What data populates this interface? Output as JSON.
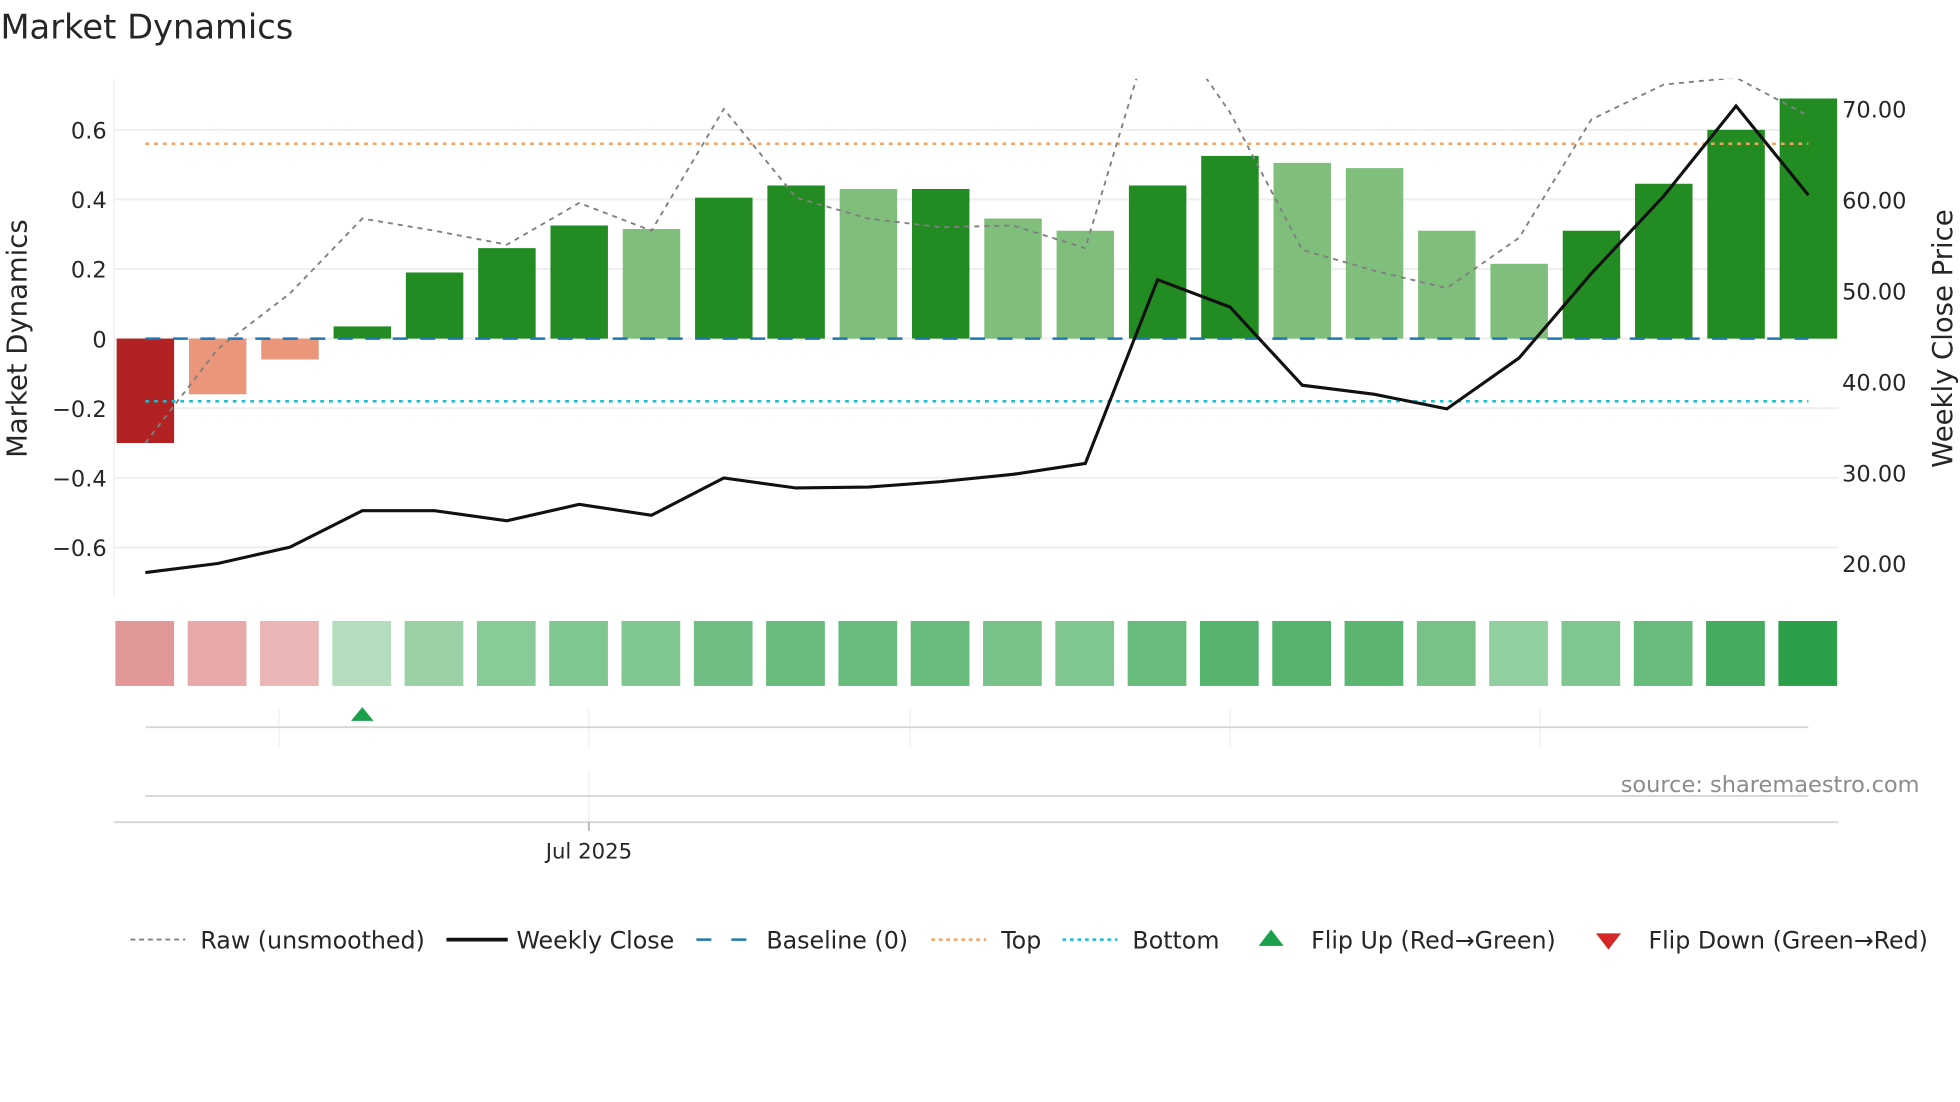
{
  "title": "Market Dynamics",
  "source": "source: sharemaestro.com",
  "colors": {
    "strong_neg": "#b22222",
    "weak_neg": "#e9967a",
    "strong_pos": "#228b22",
    "weak_pos": "#7fbf7b",
    "raw": "#808080",
    "close": "#111111",
    "baseline": "#1f77b4",
    "top": "#f4a460",
    "bottom": "#17becf",
    "flip_up": "#1a9f4a",
    "flip_down": "#d62728"
  },
  "chart_data": {
    "type": "bar",
    "title": "Market Dynamics",
    "ylabel": "Market Dynamics",
    "y2label": "Weekly Close Price",
    "ylim": [
      -0.75,
      0.75
    ],
    "y2lim": [
      16,
      74
    ],
    "yticks": [
      "0.6",
      "0.4",
      "0.2",
      "0",
      "−0.2",
      "−0.4",
      "−0.6"
    ],
    "ytick_values": [
      0.6,
      0.4,
      0.2,
      0,
      -0.2,
      -0.4,
      -0.6
    ],
    "y2ticks": [
      "70.00",
      "60.00",
      "50.00",
      "40.00",
      "30.00",
      "20.00"
    ],
    "y2tick_values": [
      70,
      60,
      50,
      40,
      30,
      20
    ],
    "xtick_label": "Jul 2025",
    "xtick_index": 6.0,
    "bars": [
      -0.3,
      -0.16,
      -0.06,
      0.035,
      0.19,
      0.26,
      0.325,
      0.315,
      0.405,
      0.44,
      0.43,
      0.43,
      0.345,
      0.31,
      0.44,
      0.525,
      0.505,
      0.49,
      0.31,
      0.215,
      0.31,
      0.445,
      0.6,
      0.69
    ],
    "bar_strength": [
      "strong",
      "weak",
      "weak",
      "strong",
      "strong",
      "strong",
      "strong",
      "weak",
      "strong",
      "strong",
      "weak",
      "strong",
      "weak",
      "weak",
      "strong",
      "strong",
      "weak",
      "weak",
      "weak",
      "weak",
      "strong",
      "strong",
      "strong",
      "strong"
    ],
    "raw": [
      -0.3,
      -0.03,
      0.13,
      0.345,
      0.31,
      0.27,
      0.39,
      0.31,
      0.66,
      0.405,
      0.345,
      0.32,
      0.325,
      0.26,
      0.95,
      0.65,
      0.255,
      0.195,
      0.145,
      0.29,
      0.63,
      0.73,
      0.75,
      0.64
    ],
    "weekly_close": [
      19.0,
      20.0,
      21.8,
      25.8,
      25.8,
      24.7,
      26.5,
      25.3,
      29.4,
      28.3,
      28.4,
      29.0,
      29.8,
      31.0,
      51.2,
      48.2,
      39.6,
      38.6,
      37.0,
      42.6,
      51.9,
      60.4,
      70.3,
      60.5
    ],
    "baseline": 0,
    "top": 0.56,
    "bottom": -0.18,
    "strip_intensity": [
      -0.55,
      -0.4,
      -0.3,
      0.2,
      0.35,
      0.45,
      0.5,
      0.5,
      0.6,
      0.65,
      0.65,
      0.65,
      0.55,
      0.5,
      0.65,
      0.75,
      0.75,
      0.72,
      0.55,
      0.4,
      0.5,
      0.65,
      0.85,
      1.0
    ],
    "flip_up_indices": [
      3
    ],
    "flip_down_indices": [],
    "legend": [
      {
        "label": "Raw (unsmoothed)",
        "kind": "raw"
      },
      {
        "label": "Weekly Close",
        "kind": "close"
      },
      {
        "label": "Baseline (0)",
        "kind": "baseline"
      },
      {
        "label": "Top",
        "kind": "top"
      },
      {
        "label": "Bottom",
        "kind": "bottom"
      },
      {
        "label": "Flip Up (Red→Green)",
        "kind": "flip_up"
      },
      {
        "label": "Flip Down (Green→Red)",
        "kind": "flip_down"
      }
    ],
    "legend_position": "bottom"
  }
}
